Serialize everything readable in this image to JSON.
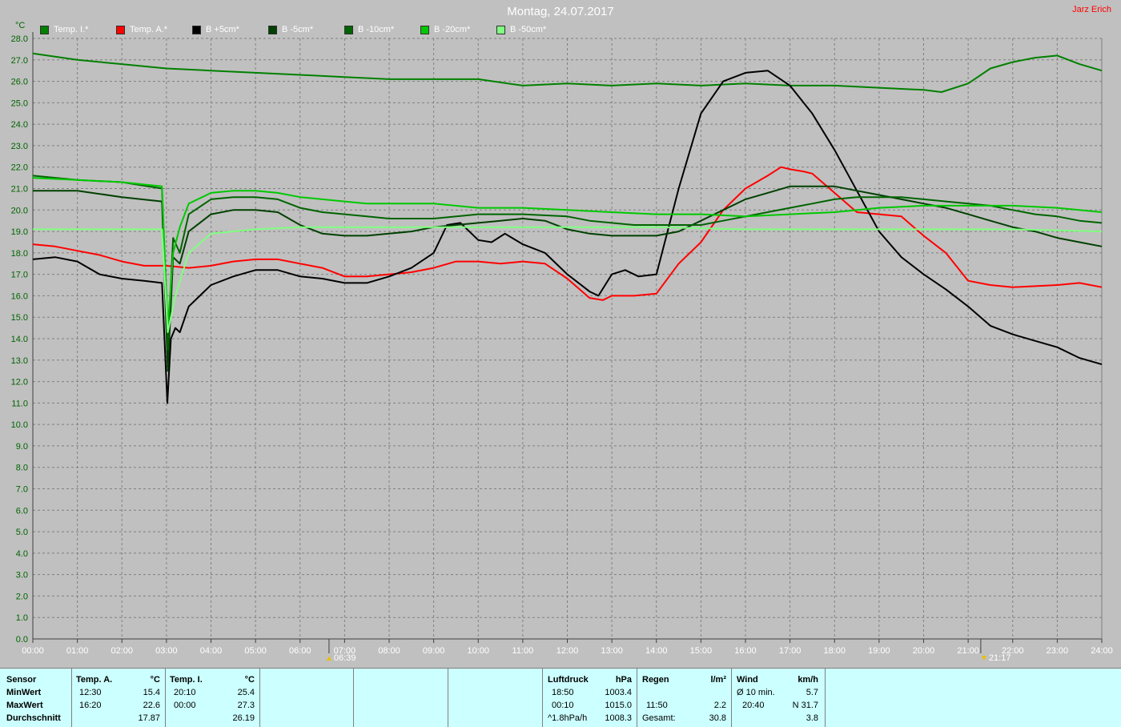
{
  "header": {
    "title": "Montag, 24.07.2017",
    "author": "Jarz Erich",
    "unit": "°C"
  },
  "sun": {
    "rise": "06:39",
    "set": "21:17"
  },
  "chart_data": {
    "type": "line",
    "xlabel": "",
    "ylabel": "°C",
    "ylim": [
      0,
      28
    ],
    "xlim": [
      0,
      24
    ],
    "y_ticks": [
      "0.0",
      "1.0",
      "2.0",
      "3.0",
      "4.0",
      "5.0",
      "6.0",
      "7.0",
      "8.0",
      "9.0",
      "10.0",
      "11.0",
      "12.0",
      "13.0",
      "14.0",
      "15.0",
      "16.0",
      "17.0",
      "18.0",
      "19.0",
      "20.0",
      "21.0",
      "22.0",
      "23.0",
      "24.0",
      "25.0",
      "26.0",
      "27.0",
      "28.0"
    ],
    "x_ticks": [
      "00:00",
      "01:00",
      "02:00",
      "03:00",
      "04:00",
      "05:00",
      "06:00",
      "07:00",
      "08:00",
      "09:00",
      "10:00",
      "11:00",
      "12:00",
      "13:00",
      "14:00",
      "15:00",
      "16:00",
      "17:00",
      "18:00",
      "19:00",
      "20:00",
      "21:00",
      "22:00",
      "23:00",
      "24:00"
    ],
    "grid": true,
    "legend": "top-left",
    "series": [
      {
        "name": "Temp. I.*",
        "color": "#008000",
        "points": [
          [
            0,
            27.3
          ],
          [
            1,
            27.0
          ],
          [
            2,
            26.8
          ],
          [
            3,
            26.6
          ],
          [
            4,
            26.5
          ],
          [
            5,
            26.4
          ],
          [
            6,
            26.3
          ],
          [
            7,
            26.2
          ],
          [
            8,
            26.1
          ],
          [
            9,
            26.1
          ],
          [
            10,
            26.1
          ],
          [
            11,
            25.8
          ],
          [
            12,
            25.9
          ],
          [
            13,
            25.8
          ],
          [
            14,
            25.9
          ],
          [
            15,
            25.8
          ],
          [
            16,
            25.9
          ],
          [
            17,
            25.8
          ],
          [
            18,
            25.8
          ],
          [
            19,
            25.7
          ],
          [
            20,
            25.6
          ],
          [
            20.4,
            25.5
          ],
          [
            21,
            25.9
          ],
          [
            21.5,
            26.6
          ],
          [
            22,
            26.9
          ],
          [
            22.5,
            27.1
          ],
          [
            23,
            27.2
          ],
          [
            23.5,
            26.8
          ],
          [
            24,
            26.5
          ]
        ]
      },
      {
        "name": "Temp. A.*",
        "color": "#ff0000",
        "points": [
          [
            0,
            18.4
          ],
          [
            0.5,
            18.3
          ],
          [
            1,
            18.1
          ],
          [
            1.5,
            17.9
          ],
          [
            2,
            17.6
          ],
          [
            2.5,
            17.4
          ],
          [
            3,
            17.4
          ],
          [
            3.5,
            17.3
          ],
          [
            4,
            17.4
          ],
          [
            4.5,
            17.6
          ],
          [
            5,
            17.7
          ],
          [
            5.5,
            17.7
          ],
          [
            6,
            17.5
          ],
          [
            6.5,
            17.3
          ],
          [
            7,
            16.9
          ],
          [
            7.5,
            16.9
          ],
          [
            8,
            17.0
          ],
          [
            8.5,
            17.1
          ],
          [
            9,
            17.3
          ],
          [
            9.5,
            17.6
          ],
          [
            10,
            17.6
          ],
          [
            10.5,
            17.5
          ],
          [
            11,
            17.6
          ],
          [
            11.5,
            17.5
          ],
          [
            12,
            16.8
          ],
          [
            12.5,
            15.9
          ],
          [
            12.8,
            15.8
          ],
          [
            13,
            16.0
          ],
          [
            13.5,
            16.0
          ],
          [
            14,
            16.1
          ],
          [
            14.5,
            17.5
          ],
          [
            15,
            18.5
          ],
          [
            15.5,
            20.0
          ],
          [
            16,
            21.0
          ],
          [
            16.5,
            21.6
          ],
          [
            16.8,
            22.0
          ],
          [
            17,
            21.9
          ],
          [
            17.3,
            21.8
          ],
          [
            17.5,
            21.7
          ],
          [
            18,
            20.8
          ],
          [
            18.5,
            19.9
          ],
          [
            19,
            19.8
          ],
          [
            19.5,
            19.7
          ],
          [
            20,
            18.8
          ],
          [
            20.5,
            18.0
          ],
          [
            21,
            16.7
          ],
          [
            21.5,
            16.5
          ],
          [
            22,
            16.4
          ],
          [
            23,
            16.5
          ],
          [
            23.5,
            16.6
          ],
          [
            24,
            16.4
          ]
        ]
      },
      {
        "name": "B +5cm*",
        "color": "#000000",
        "points": [
          [
            0,
            17.7
          ],
          [
            0.5,
            17.8
          ],
          [
            1,
            17.6
          ],
          [
            1.5,
            17.0
          ],
          [
            2,
            16.8
          ],
          [
            2.5,
            16.7
          ],
          [
            2.9,
            16.6
          ],
          [
            3.02,
            11.0
          ],
          [
            3.1,
            14.0
          ],
          [
            3.2,
            14.5
          ],
          [
            3.3,
            14.3
          ],
          [
            3.5,
            15.5
          ],
          [
            4,
            16.5
          ],
          [
            4.5,
            16.9
          ],
          [
            5,
            17.2
          ],
          [
            5.5,
            17.2
          ],
          [
            6,
            16.9
          ],
          [
            6.5,
            16.8
          ],
          [
            7,
            16.6
          ],
          [
            7.5,
            16.6
          ],
          [
            8,
            16.9
          ],
          [
            8.5,
            17.3
          ],
          [
            9,
            18.0
          ],
          [
            9.3,
            19.3
          ],
          [
            9.6,
            19.4
          ],
          [
            10,
            18.6
          ],
          [
            10.3,
            18.5
          ],
          [
            10.6,
            18.9
          ],
          [
            11,
            18.4
          ],
          [
            11.5,
            18.0
          ],
          [
            12,
            17.0
          ],
          [
            12.5,
            16.2
          ],
          [
            12.7,
            16.0
          ],
          [
            13,
            17.0
          ],
          [
            13.3,
            17.2
          ],
          [
            13.6,
            16.9
          ],
          [
            14,
            17.0
          ],
          [
            14.5,
            21.0
          ],
          [
            15,
            24.5
          ],
          [
            15.5,
            26.0
          ],
          [
            16,
            26.4
          ],
          [
            16.5,
            26.5
          ],
          [
            17,
            25.8
          ],
          [
            17.5,
            24.5
          ],
          [
            18,
            22.8
          ],
          [
            18.5,
            20.9
          ],
          [
            19,
            19.0
          ],
          [
            19.5,
            17.8
          ],
          [
            20,
            17.0
          ],
          [
            20.5,
            16.3
          ],
          [
            21,
            15.5
          ],
          [
            21.5,
            14.6
          ],
          [
            22,
            14.2
          ],
          [
            22.5,
            13.9
          ],
          [
            23,
            13.6
          ],
          [
            23.5,
            13.1
          ],
          [
            24,
            12.8
          ]
        ]
      },
      {
        "name": "B -5cm*",
        "color": "#004000",
        "points": [
          [
            0,
            20.9
          ],
          [
            1,
            20.9
          ],
          [
            2,
            20.6
          ],
          [
            2.9,
            20.4
          ],
          [
            3.03,
            12.5
          ],
          [
            3.15,
            17.8
          ],
          [
            3.3,
            17.5
          ],
          [
            3.5,
            19.0
          ],
          [
            4,
            19.8
          ],
          [
            4.5,
            20.0
          ],
          [
            5,
            20.0
          ],
          [
            5.5,
            19.9
          ],
          [
            6,
            19.3
          ],
          [
            6.5,
            18.9
          ],
          [
            7,
            18.8
          ],
          [
            7.5,
            18.8
          ],
          [
            8,
            18.9
          ],
          [
            8.5,
            19.0
          ],
          [
            9,
            19.2
          ],
          [
            9.5,
            19.3
          ],
          [
            10,
            19.4
          ],
          [
            10.5,
            19.5
          ],
          [
            11,
            19.6
          ],
          [
            11.5,
            19.5
          ],
          [
            12,
            19.1
          ],
          [
            12.5,
            18.9
          ],
          [
            13,
            18.8
          ],
          [
            13.5,
            18.8
          ],
          [
            14,
            18.8
          ],
          [
            14.5,
            19.0
          ],
          [
            15,
            19.5
          ],
          [
            15.5,
            20.0
          ],
          [
            16,
            20.5
          ],
          [
            16.5,
            20.8
          ],
          [
            17,
            21.1
          ],
          [
            17.5,
            21.1
          ],
          [
            18,
            21.1
          ],
          [
            18.5,
            20.9
          ],
          [
            19,
            20.7
          ],
          [
            19.5,
            20.5
          ],
          [
            20,
            20.3
          ],
          [
            20.5,
            20.1
          ],
          [
            21,
            19.8
          ],
          [
            21.5,
            19.5
          ],
          [
            22,
            19.2
          ],
          [
            22.5,
            19.0
          ],
          [
            23,
            18.7
          ],
          [
            23.5,
            18.5
          ],
          [
            24,
            18.3
          ]
        ]
      },
      {
        "name": "B -10cm*",
        "color": "#006400",
        "points": [
          [
            0,
            21.6
          ],
          [
            1,
            21.4
          ],
          [
            2,
            21.3
          ],
          [
            2.9,
            21.0
          ],
          [
            3.03,
            13.5
          ],
          [
            3.15,
            18.7
          ],
          [
            3.3,
            18.0
          ],
          [
            3.5,
            19.8
          ],
          [
            4,
            20.5
          ],
          [
            4.5,
            20.6
          ],
          [
            5,
            20.6
          ],
          [
            5.5,
            20.5
          ],
          [
            6,
            20.1
          ],
          [
            6.5,
            19.9
          ],
          [
            7,
            19.8
          ],
          [
            7.5,
            19.7
          ],
          [
            8,
            19.6
          ],
          [
            9,
            19.6
          ],
          [
            10,
            19.8
          ],
          [
            11,
            19.8
          ],
          [
            12,
            19.7
          ],
          [
            12.5,
            19.5
          ],
          [
            13,
            19.4
          ],
          [
            13.5,
            19.3
          ],
          [
            14,
            19.3
          ],
          [
            15,
            19.3
          ],
          [
            15.5,
            19.5
          ],
          [
            16,
            19.7
          ],
          [
            16.5,
            19.9
          ],
          [
            17,
            20.1
          ],
          [
            17.5,
            20.3
          ],
          [
            18,
            20.5
          ],
          [
            18.5,
            20.6
          ],
          [
            19,
            20.6
          ],
          [
            19.5,
            20.6
          ],
          [
            20,
            20.5
          ],
          [
            20.5,
            20.4
          ],
          [
            21,
            20.3
          ],
          [
            21.5,
            20.2
          ],
          [
            22,
            20.0
          ],
          [
            22.5,
            19.8
          ],
          [
            23,
            19.7
          ],
          [
            23.5,
            19.5
          ],
          [
            24,
            19.4
          ]
        ]
      },
      {
        "name": "B -20cm*",
        "color": "#00c800",
        "points": [
          [
            0,
            21.5
          ],
          [
            1,
            21.4
          ],
          [
            2,
            21.3
          ],
          [
            2.9,
            21.1
          ],
          [
            3.03,
            14.5
          ],
          [
            3.15,
            18.0
          ],
          [
            3.3,
            19.2
          ],
          [
            3.5,
            20.3
          ],
          [
            4,
            20.8
          ],
          [
            4.5,
            20.9
          ],
          [
            5,
            20.9
          ],
          [
            5.5,
            20.8
          ],
          [
            6,
            20.6
          ],
          [
            6.5,
            20.5
          ],
          [
            7,
            20.4
          ],
          [
            7.5,
            20.3
          ],
          [
            8,
            20.3
          ],
          [
            9,
            20.3
          ],
          [
            10,
            20.1
          ],
          [
            11,
            20.1
          ],
          [
            12,
            20.0
          ],
          [
            13,
            19.9
          ],
          [
            14,
            19.8
          ],
          [
            15,
            19.8
          ],
          [
            16,
            19.7
          ],
          [
            17,
            19.8
          ],
          [
            18,
            19.9
          ],
          [
            19,
            20.1
          ],
          [
            20,
            20.2
          ],
          [
            21,
            20.2
          ],
          [
            22,
            20.2
          ],
          [
            23,
            20.1
          ],
          [
            24,
            19.9
          ]
        ]
      },
      {
        "name": "B -50cm*",
        "color": "#80ff80",
        "points": [
          [
            0,
            19.1
          ],
          [
            2.9,
            19.1
          ],
          [
            3.03,
            14.3
          ],
          [
            3.2,
            16.0
          ],
          [
            3.5,
            18.0
          ],
          [
            4,
            18.9
          ],
          [
            5,
            19.1
          ],
          [
            6,
            19.2
          ],
          [
            8,
            19.2
          ],
          [
            10,
            19.2
          ],
          [
            12,
            19.2
          ],
          [
            14,
            19.2
          ],
          [
            16,
            19.1
          ],
          [
            18,
            19.1
          ],
          [
            20,
            19.1
          ],
          [
            22,
            19.1
          ],
          [
            24,
            19.0
          ]
        ]
      }
    ]
  },
  "stats": {
    "sensor": {
      "title": "Sensor",
      "min": "MinWert",
      "max": "MaxWert",
      "avg": "Durchschnitt"
    },
    "temp_a": {
      "title": "Temp. A.",
      "unit": "°C",
      "min_time": "12:30",
      "min_val": "15.4",
      "max_time": "16:20",
      "max_val": "22.6",
      "avg": "17.87"
    },
    "temp_i": {
      "title": "Temp. I.",
      "unit": "°C",
      "min_time": "20:10",
      "min_val": "25.4",
      "max_time": "00:00",
      "max_val": "27.3",
      "avg": "26.19"
    },
    "pressure": {
      "title": "Luftdruck",
      "unit": "hPa",
      "min_time": "18:50",
      "min_val": "1003.4",
      "max_time": "00:10",
      "max_val": "1015.0",
      "trend": "^1.8hPa/h",
      "avg": "1008.3"
    },
    "rain": {
      "title": "Regen",
      "unit": "l/m²",
      "time": "11:50",
      "val": "2.2",
      "total_label": "Gesamt:",
      "total": "30.8"
    },
    "wind": {
      "title": "Wind",
      "unit": "km/h",
      "avg_label": "Ø 10 min.",
      "avg_val": "5.7",
      "max_time": "20:40",
      "max_val": "N 31.7",
      "avg": "3.8"
    }
  }
}
